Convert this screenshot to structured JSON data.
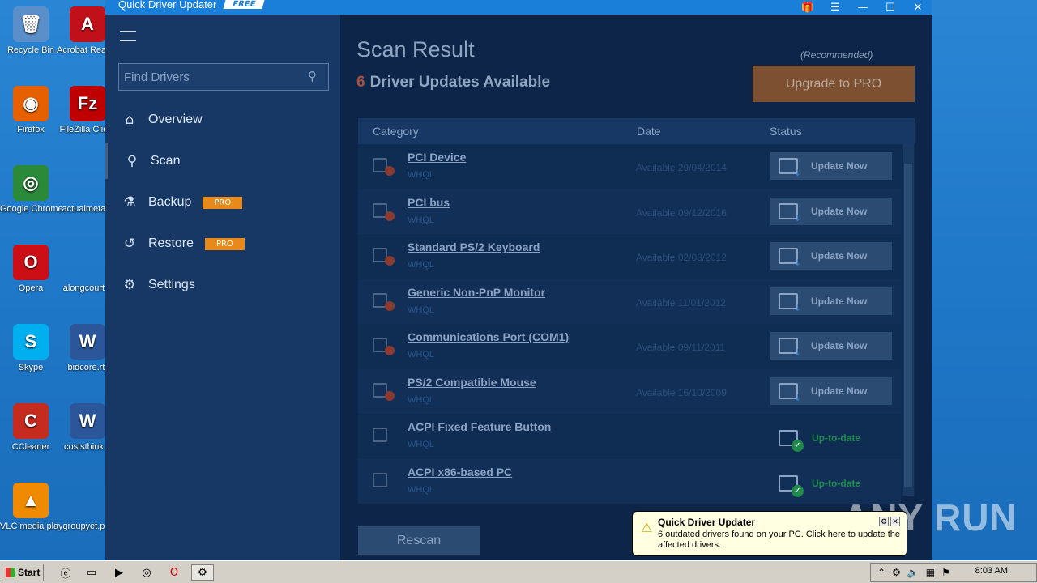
{
  "desktop": {
    "icons": [
      {
        "label": "Recycle Bin",
        "glyph": "🗑",
        "color": "#5b8fc9"
      },
      {
        "label": "Acrobat Reader DC",
        "glyph": "A",
        "color": "#c0101a"
      },
      {
        "label": "Firefox",
        "glyph": "◉",
        "color": "#e66000"
      },
      {
        "label": "FileZilla Client",
        "glyph": "Fz",
        "color": "#bf0000"
      },
      {
        "label": "Google Chrome",
        "glyph": "◎",
        "color": "#2a8a3a"
      },
      {
        "label": "actualmeta...",
        "glyph": "",
        "color": "transparent"
      },
      {
        "label": "Opera",
        "glyph": "O",
        "color": "#cc0f16"
      },
      {
        "label": "alongcourt...",
        "glyph": "",
        "color": "transparent"
      },
      {
        "label": "Skype",
        "glyph": "S",
        "color": "#00aff0"
      },
      {
        "label": "bidcore.rtf",
        "glyph": "W",
        "color": "#2b579a"
      },
      {
        "label": "CCleaner",
        "glyph": "C",
        "color": "#c62b1f"
      },
      {
        "label": "coststhink...",
        "glyph": "W",
        "color": "#2b579a"
      },
      {
        "label": "VLC media player",
        "glyph": "▲",
        "color": "#f08a00"
      },
      {
        "label": "groupyet.p...",
        "glyph": "",
        "color": "transparent"
      }
    ]
  },
  "app": {
    "title": "Quick Driver Updater",
    "badge": "FREE",
    "controls": {
      "gift": "🎁",
      "menu": "☰",
      "minimize": "—",
      "maximize": "☐",
      "close": "✕"
    },
    "sidebar": {
      "search_placeholder": "Find Drivers",
      "items": [
        {
          "label": "Overview",
          "icon": "⌂",
          "pro": ""
        },
        {
          "label": "Scan",
          "icon": "⚲",
          "pro": ""
        },
        {
          "label": "Backup",
          "icon": "⚗",
          "pro": "PRO"
        },
        {
          "label": "Restore",
          "icon": "↺",
          "pro": "PRO"
        },
        {
          "label": "Settings",
          "icon": "⚙",
          "pro": ""
        }
      ]
    },
    "main": {
      "title": "Scan Result",
      "count": "6",
      "subtitle": "Driver Updates Available",
      "recommended": "(Recommended)",
      "upgrade": "Upgrade to PRO",
      "columns": {
        "category": "Category",
        "date": "Date",
        "status": "Status"
      },
      "rows": [
        {
          "name": "PCI Device",
          "tag": "WHQL",
          "date": "Available 29/04/2014",
          "status": "Update Now"
        },
        {
          "name": "PCI bus",
          "tag": "WHQL",
          "date": "Available 09/12/2016",
          "status": "Update Now"
        },
        {
          "name": "Standard PS/2 Keyboard",
          "tag": "WHQL",
          "date": "Available 02/08/2012",
          "status": "Update Now"
        },
        {
          "name": "Generic Non-PnP Monitor",
          "tag": "WHQL",
          "date": "Available 11/01/2012",
          "status": "Update Now"
        },
        {
          "name": "Communications Port (COM1)",
          "tag": "WHQL",
          "date": "Available 09/11/2011",
          "status": "Update Now"
        },
        {
          "name": "PS/2 Compatible Mouse",
          "tag": "WHQL",
          "date": "Available 16/10/2009",
          "status": "Update Now"
        },
        {
          "name": "ACPI Fixed Feature Button",
          "tag": "WHQL",
          "date": "",
          "status": "Up-to-date"
        },
        {
          "name": "ACPI x86-based PC",
          "tag": "WHQL",
          "date": "",
          "status": "Up-to-date"
        }
      ],
      "rescan": "Rescan"
    }
  },
  "notification": {
    "title": "Quick Driver Updater",
    "message": "6 outdated drivers found on your PC. Click here to update the affected drivers."
  },
  "watermark": "ANY RUN",
  "taskbar": {
    "start": "Start",
    "clock": "8:03 AM"
  }
}
